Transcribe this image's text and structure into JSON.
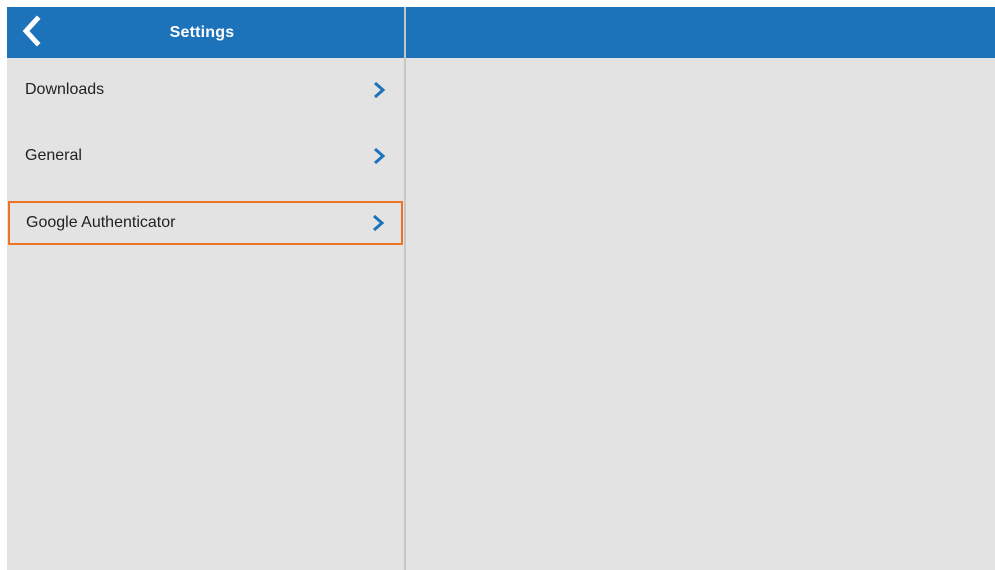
{
  "header": {
    "title": "Settings",
    "back_icon": "chevron-left-icon"
  },
  "menu": {
    "items": [
      {
        "label": "Downloads",
        "icon": "chevron-right-icon",
        "selected": false
      },
      {
        "label": "General",
        "icon": "chevron-right-icon",
        "selected": false
      },
      {
        "label": "Google Authenticator",
        "icon": "chevron-right-icon",
        "selected": true
      }
    ]
  },
  "colors": {
    "header_bg": "#1c73ba",
    "panel_bg": "#e3e3e3",
    "accent_chevron": "#1c73ba",
    "selection_border": "#ee7325"
  }
}
